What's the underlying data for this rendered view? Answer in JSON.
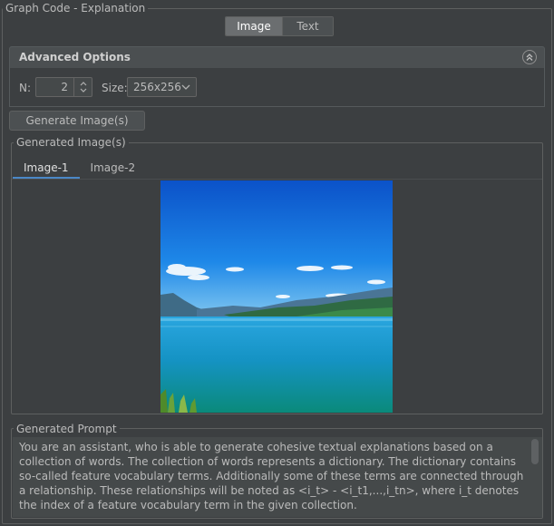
{
  "window": {
    "title": "Graph Code - Explanation"
  },
  "mode_toggle": {
    "options": [
      "Image",
      "Text"
    ],
    "selected": "Image"
  },
  "advanced": {
    "title": "Advanced Options",
    "collapse_icon": "double-chevron-up-icon",
    "n_label": "N:",
    "n_value": "2",
    "size_label": "Size:",
    "size_value": "256x256"
  },
  "generate_button": {
    "label": "Generate Image(s)"
  },
  "generated_images": {
    "legend": "Generated Image(s)",
    "tabs": [
      "Image-1",
      "Image-2"
    ],
    "selected_tab": "Image-1"
  },
  "prompt": {
    "legend": "Generated Prompt",
    "text": "You are an assistant, who is able to generate cohesive textual explanations based on a collection of words. The collection of words represents a dictionary. The dictionary contains so-called feature vocabulary terms. Additionally some of these terms are connected through a relationship. These relationships will be noted as <i_t> - <i_t1,...,i_tn>, where i_t denotes the index of a feature vocabulary term in the given collection."
  },
  "colors": {
    "background": "#3c3f41",
    "accent": "#4a88c7",
    "selected_toggle": "#6b6e70"
  }
}
